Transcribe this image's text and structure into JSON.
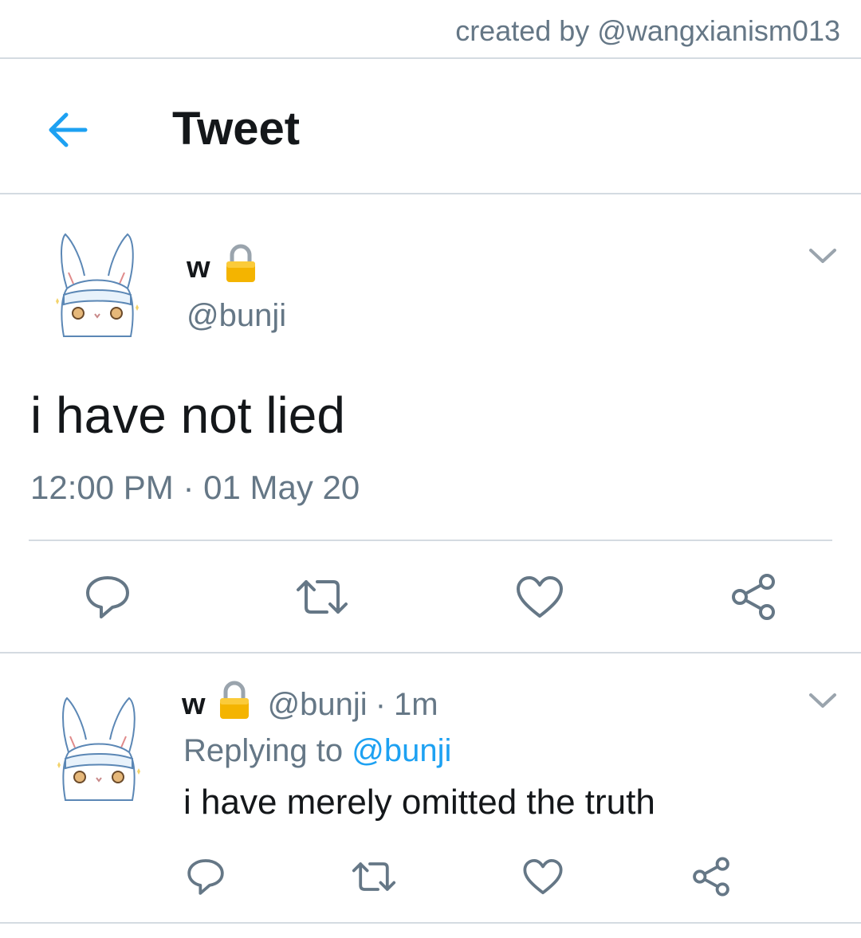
{
  "credit": "created by @wangxianism013",
  "header": {
    "title": "Tweet"
  },
  "tweet": {
    "author_name": "w",
    "author_handle": "@bunji",
    "text": "i have not lied",
    "time": "12:00 PM",
    "separator": "·",
    "date": "01 May 20"
  },
  "reply": {
    "author_name": "w",
    "author_handle": "@bunji",
    "separator": "·",
    "age": "1m",
    "replying_prefix": "Replying to",
    "replying_mention": "@bunji",
    "text": "i have merely omitted the truth"
  },
  "colors": {
    "accent": "#1da1f2",
    "muted": "#657786",
    "icon": "#657786",
    "divider": "#d4dbe1",
    "lock": "#f4b400"
  },
  "icons": [
    "back-arrow-icon",
    "lock-icon",
    "chevron-down-icon",
    "reply-icon",
    "retweet-icon",
    "like-icon",
    "share-icon",
    "bunny-avatar"
  ]
}
